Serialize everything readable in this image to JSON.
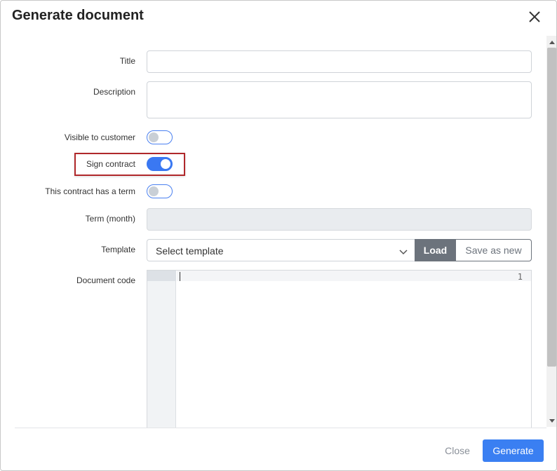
{
  "dialog": {
    "title": "Generate document",
    "close_icon": "close-icon"
  },
  "form": {
    "title_label": "Title",
    "title_value": "",
    "description_label": "Description",
    "description_value": "",
    "visible_label": "Visible to customer",
    "visible_on": false,
    "sign_label": "Sign contract",
    "sign_on": true,
    "term_toggle_label": "This contract has a term",
    "term_toggle_on": false,
    "term_label": "Term (month)",
    "term_value": "",
    "template_label": "Template",
    "template_placeholder": "Select template",
    "template_chevron_icon": "chevron-down-icon",
    "load_label": "Load",
    "save_as_new_label": "Save as new",
    "code_label": "Document code",
    "code_line_number": "1"
  },
  "footer": {
    "close_label": "Close",
    "generate_label": "Generate"
  },
  "colors": {
    "accent": "#3a7ff2",
    "highlight_border": "#b0282b",
    "load_button": "#6c737c"
  }
}
